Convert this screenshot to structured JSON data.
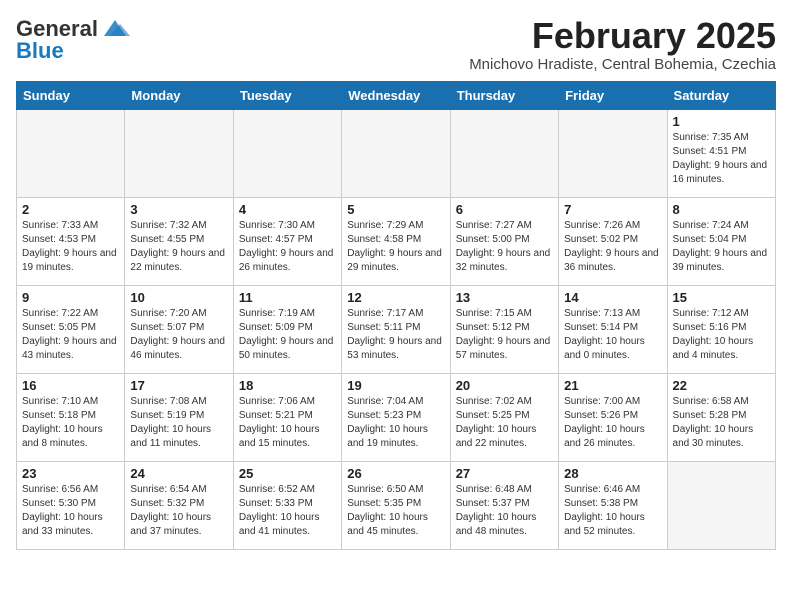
{
  "header": {
    "logo_general": "General",
    "logo_blue": "Blue",
    "month_title": "February 2025",
    "location": "Mnichovo Hradiste, Central Bohemia, Czechia"
  },
  "weekdays": [
    "Sunday",
    "Monday",
    "Tuesday",
    "Wednesday",
    "Thursday",
    "Friday",
    "Saturday"
  ],
  "weeks": [
    [
      {
        "day": "",
        "empty": true
      },
      {
        "day": "",
        "empty": true
      },
      {
        "day": "",
        "empty": true
      },
      {
        "day": "",
        "empty": true
      },
      {
        "day": "",
        "empty": true
      },
      {
        "day": "",
        "empty": true
      },
      {
        "day": "1",
        "sunrise": "7:35 AM",
        "sunset": "4:51 PM",
        "daylight": "9 hours and 16 minutes."
      }
    ],
    [
      {
        "day": "2",
        "sunrise": "7:33 AM",
        "sunset": "4:53 PM",
        "daylight": "9 hours and 19 minutes."
      },
      {
        "day": "3",
        "sunrise": "7:32 AM",
        "sunset": "4:55 PM",
        "daylight": "9 hours and 22 minutes."
      },
      {
        "day": "4",
        "sunrise": "7:30 AM",
        "sunset": "4:57 PM",
        "daylight": "9 hours and 26 minutes."
      },
      {
        "day": "5",
        "sunrise": "7:29 AM",
        "sunset": "4:58 PM",
        "daylight": "9 hours and 29 minutes."
      },
      {
        "day": "6",
        "sunrise": "7:27 AM",
        "sunset": "5:00 PM",
        "daylight": "9 hours and 32 minutes."
      },
      {
        "day": "7",
        "sunrise": "7:26 AM",
        "sunset": "5:02 PM",
        "daylight": "9 hours and 36 minutes."
      },
      {
        "day": "8",
        "sunrise": "7:24 AM",
        "sunset": "5:04 PM",
        "daylight": "9 hours and 39 minutes."
      }
    ],
    [
      {
        "day": "9",
        "sunrise": "7:22 AM",
        "sunset": "5:05 PM",
        "daylight": "9 hours and 43 minutes."
      },
      {
        "day": "10",
        "sunrise": "7:20 AM",
        "sunset": "5:07 PM",
        "daylight": "9 hours and 46 minutes."
      },
      {
        "day": "11",
        "sunrise": "7:19 AM",
        "sunset": "5:09 PM",
        "daylight": "9 hours and 50 minutes."
      },
      {
        "day": "12",
        "sunrise": "7:17 AM",
        "sunset": "5:11 PM",
        "daylight": "9 hours and 53 minutes."
      },
      {
        "day": "13",
        "sunrise": "7:15 AM",
        "sunset": "5:12 PM",
        "daylight": "9 hours and 57 minutes."
      },
      {
        "day": "14",
        "sunrise": "7:13 AM",
        "sunset": "5:14 PM",
        "daylight": "10 hours and 0 minutes."
      },
      {
        "day": "15",
        "sunrise": "7:12 AM",
        "sunset": "5:16 PM",
        "daylight": "10 hours and 4 minutes."
      }
    ],
    [
      {
        "day": "16",
        "sunrise": "7:10 AM",
        "sunset": "5:18 PM",
        "daylight": "10 hours and 8 minutes."
      },
      {
        "day": "17",
        "sunrise": "7:08 AM",
        "sunset": "5:19 PM",
        "daylight": "10 hours and 11 minutes."
      },
      {
        "day": "18",
        "sunrise": "7:06 AM",
        "sunset": "5:21 PM",
        "daylight": "10 hours and 15 minutes."
      },
      {
        "day": "19",
        "sunrise": "7:04 AM",
        "sunset": "5:23 PM",
        "daylight": "10 hours and 19 minutes."
      },
      {
        "day": "20",
        "sunrise": "7:02 AM",
        "sunset": "5:25 PM",
        "daylight": "10 hours and 22 minutes."
      },
      {
        "day": "21",
        "sunrise": "7:00 AM",
        "sunset": "5:26 PM",
        "daylight": "10 hours and 26 minutes."
      },
      {
        "day": "22",
        "sunrise": "6:58 AM",
        "sunset": "5:28 PM",
        "daylight": "10 hours and 30 minutes."
      }
    ],
    [
      {
        "day": "23",
        "sunrise": "6:56 AM",
        "sunset": "5:30 PM",
        "daylight": "10 hours and 33 minutes."
      },
      {
        "day": "24",
        "sunrise": "6:54 AM",
        "sunset": "5:32 PM",
        "daylight": "10 hours and 37 minutes."
      },
      {
        "day": "25",
        "sunrise": "6:52 AM",
        "sunset": "5:33 PM",
        "daylight": "10 hours and 41 minutes."
      },
      {
        "day": "26",
        "sunrise": "6:50 AM",
        "sunset": "5:35 PM",
        "daylight": "10 hours and 45 minutes."
      },
      {
        "day": "27",
        "sunrise": "6:48 AM",
        "sunset": "5:37 PM",
        "daylight": "10 hours and 48 minutes."
      },
      {
        "day": "28",
        "sunrise": "6:46 AM",
        "sunset": "5:38 PM",
        "daylight": "10 hours and 52 minutes."
      },
      {
        "day": "",
        "empty": true
      }
    ]
  ]
}
